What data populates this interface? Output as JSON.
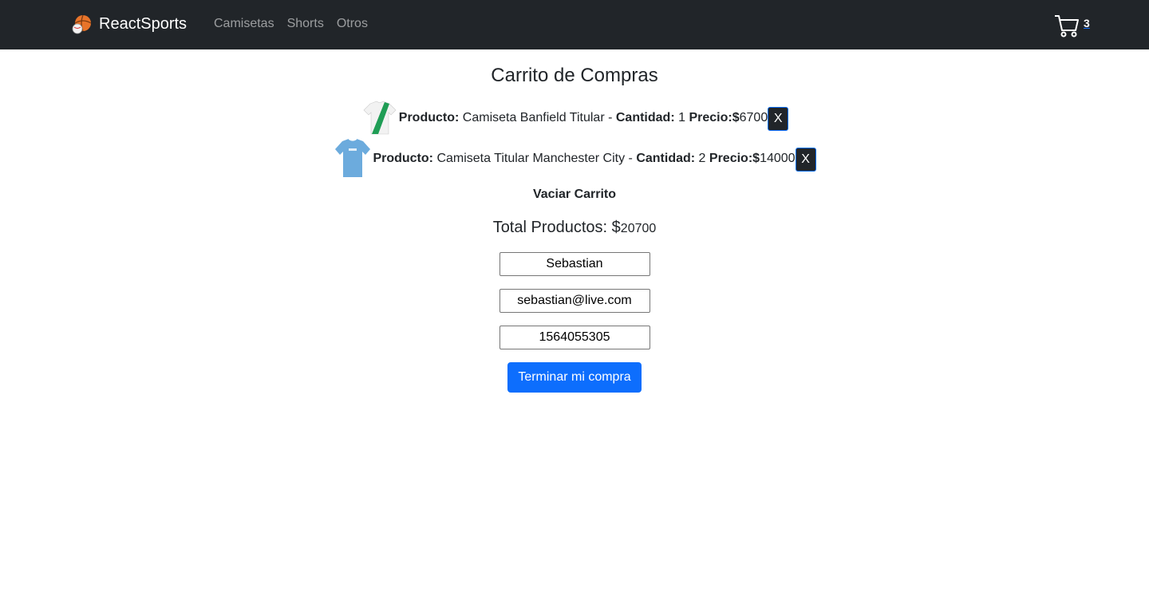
{
  "nav": {
    "brand": "ReactSports",
    "links": [
      {
        "label": "Camisetas"
      },
      {
        "label": "Shorts"
      },
      {
        "label": "Otros"
      }
    ],
    "cart_count": "3"
  },
  "cart": {
    "title": "Carrito de Compras",
    "product_label": "Producto:",
    "quantity_label": "Cantidad:",
    "price_label": "Precio:",
    "currency": "$",
    "separator": "-",
    "remove_label": "X",
    "items": [
      {
        "name": "Camiseta Banfield Titular",
        "quantity": "1",
        "price": "6700",
        "thumb_colors": {
          "primary": "#f2f2f2",
          "accent": "#1f9d55"
        }
      },
      {
        "name": "Camiseta Titular Manchester City",
        "quantity": "2",
        "price": "14000",
        "thumb_colors": {
          "primary": "#6cabdd",
          "accent": "#ffffff"
        }
      }
    ],
    "clear_label": "Vaciar Carrito",
    "total_label": "Total Productos:",
    "total_currency": "$",
    "total_value": "20700"
  },
  "form": {
    "name_value": "Sebastian",
    "email_value": "sebastian@live.com",
    "phone_value": "1564055305",
    "submit_label": "Terminar mi compra"
  },
  "colors": {
    "navbar_bg": "#212529",
    "primary": "#0d6efd"
  }
}
